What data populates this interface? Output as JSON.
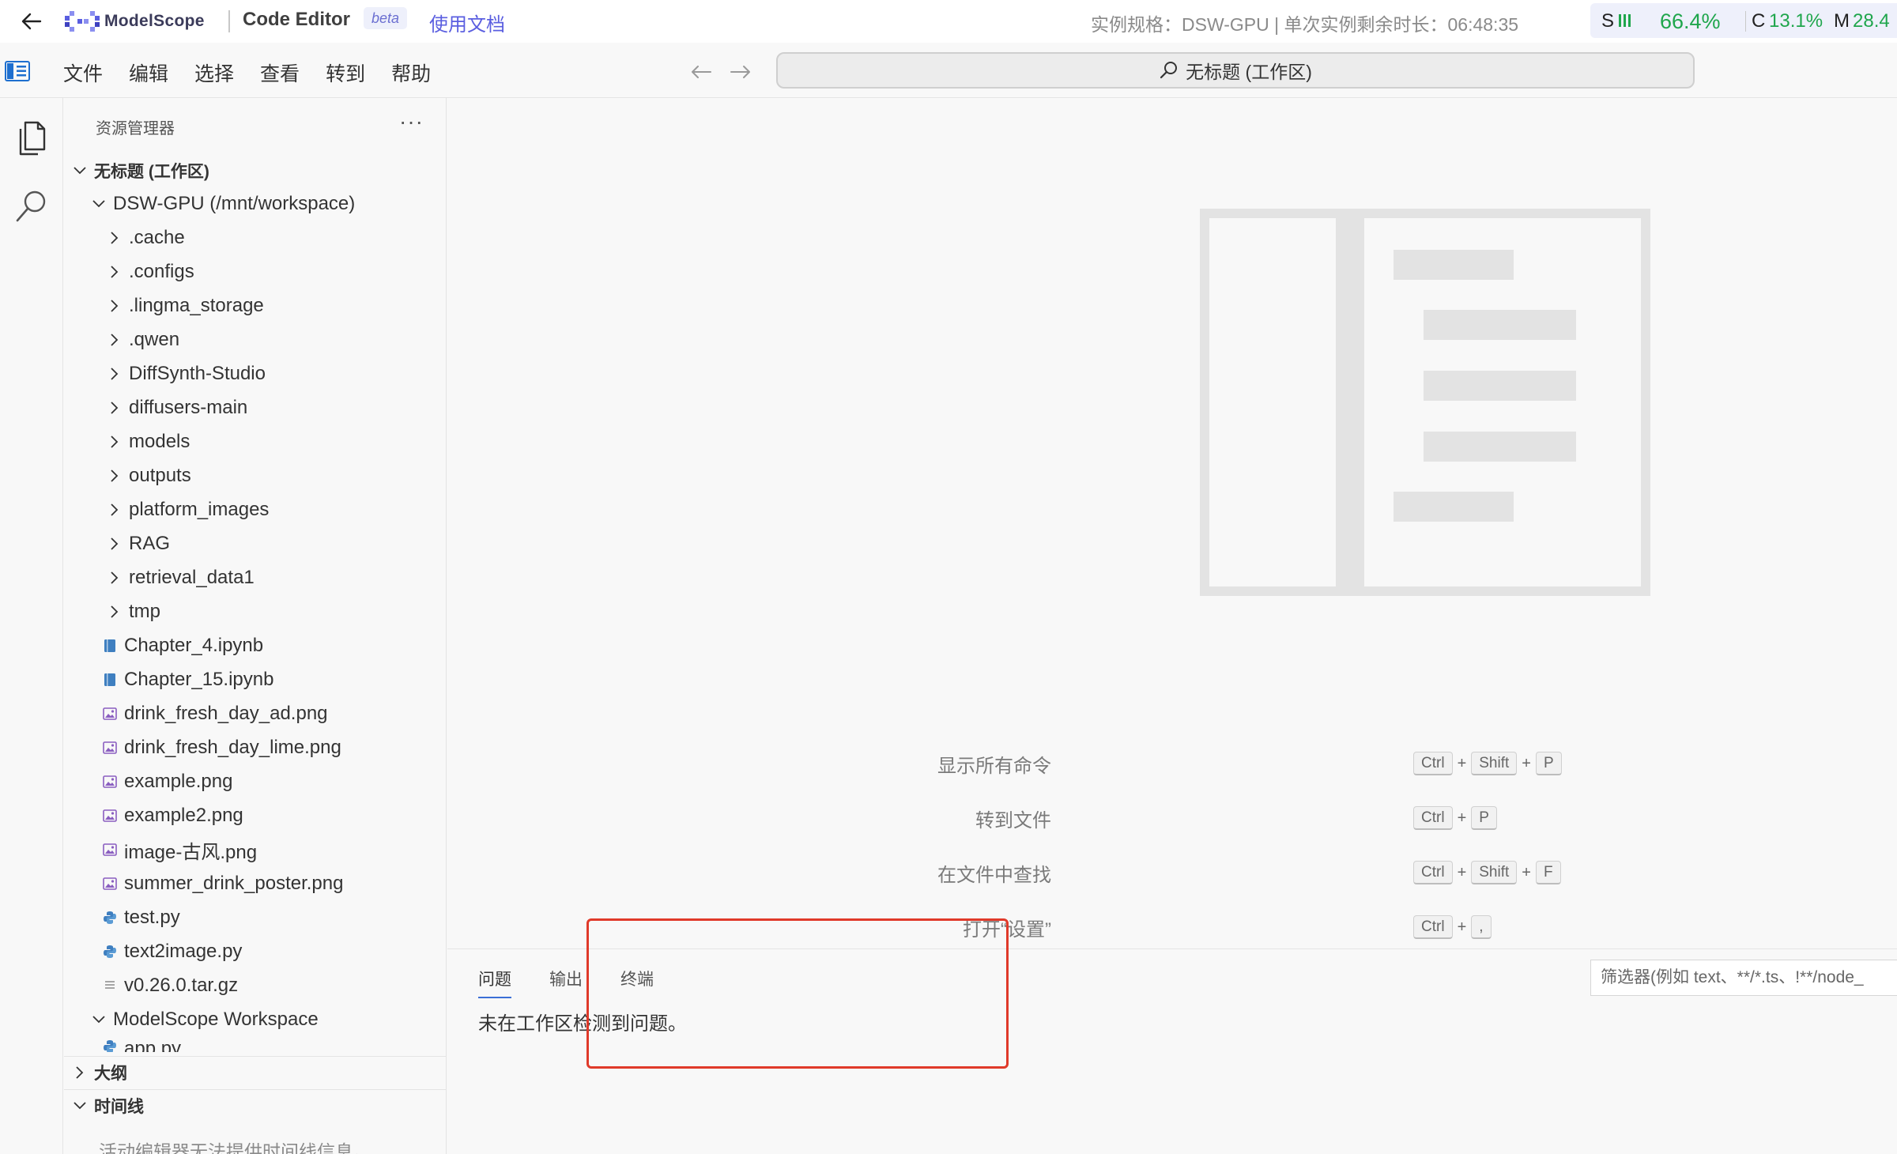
{
  "topbar": {
    "logo_text": "ModelScope",
    "app_title": "Code Editor",
    "beta_label": "beta",
    "docs_link": "使用文档",
    "instance_info": "实例规格：DSW-GPU  |  单次实例剩余时长：06:48:35",
    "stats": {
      "s_label": "S",
      "gpu_value": "66.4%",
      "c_label": "C",
      "c_value": "13.1%",
      "m_label": "M",
      "m_value": "28.4"
    }
  },
  "menubar": {
    "items": [
      "文件",
      "编辑",
      "选择",
      "查看",
      "转到",
      "帮助"
    ],
    "command_center": "无标题 (工作区)"
  },
  "sidebar": {
    "header": "资源管理器",
    "more": "···",
    "workspace_label": "无标题 (工作区)",
    "root_folder": "DSW-GPU (/mnt/workspace)",
    "folders": [
      ".cache",
      ".configs",
      ".lingma_storage",
      ".qwen",
      "DiffSynth-Studio",
      "diffusers-main",
      "models",
      "outputs",
      "platform_images",
      "RAG",
      "retrieval_data1",
      "tmp"
    ],
    "files": [
      {
        "name": "Chapter_4.ipynb",
        "icon": "notebook-icon"
      },
      {
        "name": "Chapter_15.ipynb",
        "icon": "notebook-icon"
      },
      {
        "name": "drink_fresh_day_ad.png",
        "icon": "image-file-icon"
      },
      {
        "name": "drink_fresh_day_lime.png",
        "icon": "image-file-icon"
      },
      {
        "name": "example.png",
        "icon": "image-file-icon"
      },
      {
        "name": "example2.png",
        "icon": "image-file-icon"
      },
      {
        "name": "image-古风.png",
        "icon": "image-file-icon"
      },
      {
        "name": "summer_drink_poster.png",
        "icon": "image-file-icon"
      },
      {
        "name": "test.py",
        "icon": "python-file-icon"
      },
      {
        "name": "text2image.py",
        "icon": "python-file-icon"
      },
      {
        "name": "v0.26.0.tar.gz",
        "icon": "archive-file-icon"
      }
    ],
    "second_root": "ModelScope Workspace",
    "partial_file": "app.py",
    "outline_label": "大纲",
    "timeline_label": "时间线",
    "timeline_message": "活动编辑器无法提供时间线信息。"
  },
  "editor": {
    "shortcuts": [
      {
        "label": "显示所有命令",
        "keys": [
          "Ctrl",
          "Shift",
          "P"
        ]
      },
      {
        "label": "转到文件",
        "keys": [
          "Ctrl",
          "P"
        ]
      },
      {
        "label": "在文件中查找",
        "keys": [
          "Ctrl",
          "Shift",
          "F"
        ]
      },
      {
        "label": "打开“设置”",
        "keys": [
          "Ctrl",
          ","
        ]
      }
    ]
  },
  "panel": {
    "tabs": [
      "问题",
      "输出",
      "终端"
    ],
    "active_tab": "问题",
    "filter_placeholder": "筛选器(例如 text、**/*.ts、!**/node_",
    "message": "未在工作区检测到问题。"
  },
  "colors": {
    "accent": "#3b6fd6",
    "stat_green": "#1fa64c",
    "highlight": "#e03a2a",
    "brand": "#5a5ee0"
  }
}
